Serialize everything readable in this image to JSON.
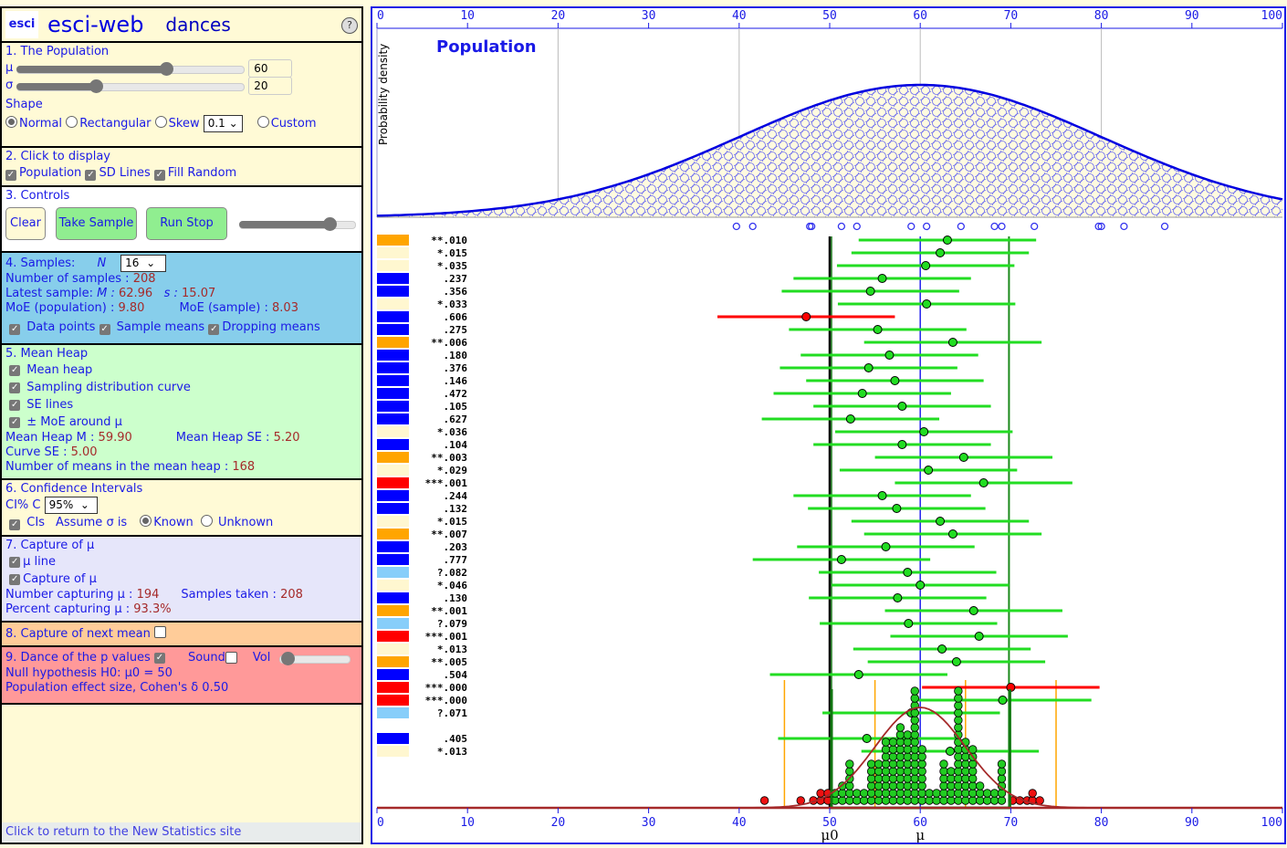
{
  "app": {
    "name": "esci-web",
    "module": "dances",
    "logo": "esci",
    "help_icon": "?"
  },
  "population": {
    "heading": "1. The Population",
    "mu_label": "μ",
    "mu_value": "60",
    "mu_fraction": 0.6,
    "sigma_label": "σ",
    "sigma_value": "20",
    "sigma_fraction": 0.35,
    "shape_label": "Shape",
    "shapes": [
      {
        "label": "Normal",
        "selected": true
      },
      {
        "label": "Rectangular",
        "selected": false
      },
      {
        "label": "Skew",
        "selected": false
      },
      {
        "label": "Custom",
        "selected": false
      }
    ],
    "skew_value": "0.1"
  },
  "display": {
    "heading": "2. Click to display",
    "options": [
      {
        "label": "Population",
        "checked": true
      },
      {
        "label": "SD Lines",
        "checked": true
      },
      {
        "label": "Fill Random",
        "checked": true
      }
    ]
  },
  "controls": {
    "heading": "3. Controls",
    "clear": "Clear",
    "take_sample": "Take Sample",
    "run_stop": "Run Stop",
    "speed_fraction": 0.78
  },
  "samples": {
    "heading": "4. Samples:",
    "n_label": "N",
    "n_value": "16",
    "num_samples_label": "Number of samples :",
    "num_samples": "208",
    "latest_label": "Latest sample:",
    "m_label": "M :",
    "m_value": "62.96",
    "s_label": "s :",
    "s_value": "15.07",
    "moe_pop_label": "MoE (population) :",
    "moe_pop": "9.80",
    "moe_sample_label": "MoE (sample) :",
    "moe_sample": "8.03",
    "options": [
      {
        "label": "Data points",
        "checked": true
      },
      {
        "label": "Sample means",
        "checked": true
      },
      {
        "label": "Dropping means",
        "checked": true
      }
    ]
  },
  "mean_heap": {
    "heading": "5. Mean Heap",
    "options": [
      {
        "label": "Mean heap",
        "checked": true
      },
      {
        "label": "Sampling distribution curve",
        "checked": true
      },
      {
        "label": "SE lines",
        "checked": true
      },
      {
        "label": "± MoE around μ",
        "checked": true
      }
    ],
    "m_label": "Mean Heap M :",
    "m_value": "59.90",
    "se_label": "Mean Heap SE :",
    "se_value": "5.20",
    "curve_se_label": "Curve SE :",
    "curve_se": "5.00",
    "count_label": "Number of means in the mean heap :",
    "count": "168"
  },
  "ci": {
    "heading": "6. Confidence Intervals",
    "ci_label": "CI% C",
    "ci_value": "95%",
    "cis_label": "CIs",
    "cis_checked": true,
    "assume_label": "Assume σ is",
    "known": "Known",
    "unknown": "Unknown",
    "known_selected": true
  },
  "capture": {
    "heading": "7. Capture of μ",
    "options": [
      {
        "label": "μ line",
        "checked": true
      },
      {
        "label": "Capture of μ",
        "checked": true
      }
    ],
    "num_label": "Number capturing μ :",
    "num": "194",
    "taken_label": "Samples taken :",
    "taken": "208",
    "pct_label": "Percent capturing μ :",
    "pct": "93.3%"
  },
  "next_mean": {
    "heading": "8. Capture of next mean",
    "checked": false
  },
  "pvalues": {
    "heading": "9. Dance of the p values",
    "checked": true,
    "sound_label": "Sound",
    "sound_checked": false,
    "vol_label": "Vol",
    "vol_fraction": 0.1,
    "h0_label": "Null hypothesis H0: μ0 = 50",
    "effect_label": "Population effect size, Cohen's δ 0.50"
  },
  "footer_link": "Click to return to the New Statistics site",
  "colors": {
    "sig3": "#ff0000",
    "sig2": "#ffa500",
    "sig1": "#fff7d0",
    "marginal": "#87cefa",
    "ns": "#0000ff",
    "ci_capture": "#22dd22",
    "ci_miss": "#ff0000"
  },
  "chart_data": {
    "type": "scatter",
    "title": "Population",
    "ylabel": "Probability density",
    "xlim": [
      0,
      100
    ],
    "x_ticks": [
      0,
      10,
      20,
      30,
      40,
      50,
      60,
      70,
      80,
      90,
      100
    ],
    "mu": 60,
    "sigma": 20,
    "mu0": 50,
    "moe": 9.8,
    "se": 5.0,
    "mu_label": "μ",
    "mu0_label": "μ0",
    "latest_sample_points": [
      39.7,
      41.5,
      47.8,
      48.0,
      51.3,
      53.0,
      59.0,
      60.7,
      64.5,
      68.2,
      69.0,
      72.6,
      79.7,
      80.0,
      82.5,
      87.0
    ],
    "intervals": [
      {
        "p": "**.010",
        "cat": "sig2",
        "mean": 63.0
      },
      {
        "p": "*.015",
        "cat": "sig1",
        "mean": 62.2
      },
      {
        "p": "*.035",
        "cat": "sig1",
        "mean": 60.6
      },
      {
        "p": ".237",
        "cat": "ns",
        "mean": 55.8
      },
      {
        "p": ".356",
        "cat": "ns",
        "mean": 54.5
      },
      {
        "p": "*.033",
        "cat": "sig1",
        "mean": 60.7
      },
      {
        "p": ".606",
        "cat": "ns",
        "mean": 47.4,
        "miss": true
      },
      {
        "p": ".275",
        "cat": "ns",
        "mean": 55.3
      },
      {
        "p": "**.006",
        "cat": "sig2",
        "mean": 63.6
      },
      {
        "p": ".180",
        "cat": "ns",
        "mean": 56.6
      },
      {
        "p": ".376",
        "cat": "ns",
        "mean": 54.3
      },
      {
        "p": ".146",
        "cat": "ns",
        "mean": 57.2
      },
      {
        "p": ".472",
        "cat": "ns",
        "mean": 53.6
      },
      {
        "p": ".105",
        "cat": "ns",
        "mean": 58.0
      },
      {
        "p": ".627",
        "cat": "ns",
        "mean": 52.3
      },
      {
        "p": "*.036",
        "cat": "sig1",
        "mean": 60.4
      },
      {
        "p": ".104",
        "cat": "ns",
        "mean": 58.0
      },
      {
        "p": "**.003",
        "cat": "sig2",
        "mean": 64.8
      },
      {
        "p": "*.029",
        "cat": "sig1",
        "mean": 60.9
      },
      {
        "p": "***.001",
        "cat": "sig3",
        "mean": 67.0
      },
      {
        "p": ".244",
        "cat": "ns",
        "mean": 55.8
      },
      {
        "p": ".132",
        "cat": "ns",
        "mean": 57.4
      },
      {
        "p": "*.015",
        "cat": "sig1",
        "mean": 62.2
      },
      {
        "p": "**.007",
        "cat": "sig2",
        "mean": 63.6
      },
      {
        "p": ".203",
        "cat": "ns",
        "mean": 56.2
      },
      {
        "p": ".777",
        "cat": "ns",
        "mean": 51.3
      },
      {
        "p": "?.082",
        "cat": "marginal",
        "mean": 58.6
      },
      {
        "p": "*.046",
        "cat": "sig1",
        "mean": 60.0
      },
      {
        "p": ".130",
        "cat": "ns",
        "mean": 57.5
      },
      {
        "p": "**.001",
        "cat": "sig2",
        "mean": 65.9
      },
      {
        "p": "?.079",
        "cat": "marginal",
        "mean": 58.7
      },
      {
        "p": "***.001",
        "cat": "sig3",
        "mean": 66.5
      },
      {
        "p": "*.013",
        "cat": "sig1",
        "mean": 62.4
      },
      {
        "p": "**.005",
        "cat": "sig2",
        "mean": 64.0
      },
      {
        "p": ".504",
        "cat": "ns",
        "mean": 53.2
      },
      {
        "p": "***.000",
        "cat": "sig3",
        "mean": 70.0,
        "miss": true
      },
      {
        "p": "***.000",
        "cat": "sig3",
        "mean": 69.1
      },
      {
        "p": "?.071",
        "cat": "marginal",
        "mean": 59.0
      },
      {
        "p": "",
        "cat": "",
        "mean": null
      },
      {
        "p": ".405",
        "cat": "ns",
        "mean": 54.1
      },
      {
        "p": "*.013",
        "cat": "sig1",
        "mean": 63.3
      }
    ],
    "heap_bins": [
      {
        "x": 42.8,
        "n": 1,
        "miss": true
      },
      {
        "x": 46.8,
        "n": 1,
        "miss": true
      },
      {
        "x": 48.2,
        "n": 1,
        "miss": true
      },
      {
        "x": 49.0,
        "n": 2,
        "miss": true
      },
      {
        "x": 49.8,
        "n": 2,
        "miss": true
      },
      {
        "x": 50.6,
        "n": 2
      },
      {
        "x": 51.4,
        "n": 3
      },
      {
        "x": 52.2,
        "n": 6
      },
      {
        "x": 53.0,
        "n": 2
      },
      {
        "x": 53.8,
        "n": 2
      },
      {
        "x": 54.6,
        "n": 6
      },
      {
        "x": 55.4,
        "n": 6
      },
      {
        "x": 56.2,
        "n": 9
      },
      {
        "x": 57.0,
        "n": 9
      },
      {
        "x": 57.8,
        "n": 11
      },
      {
        "x": 58.6,
        "n": 10
      },
      {
        "x": 59.4,
        "n": 16
      },
      {
        "x": 60.2,
        "n": 8
      },
      {
        "x": 61.0,
        "n": 2
      },
      {
        "x": 61.8,
        "n": 2
      },
      {
        "x": 62.6,
        "n": 6
      },
      {
        "x": 63.4,
        "n": 5
      },
      {
        "x": 64.2,
        "n": 16
      },
      {
        "x": 65.0,
        "n": 9
      },
      {
        "x": 65.8,
        "n": 8
      },
      {
        "x": 66.6,
        "n": 3
      },
      {
        "x": 67.4,
        "n": 2
      },
      {
        "x": 68.2,
        "n": 2
      },
      {
        "x": 69.0,
        "n": 6
      },
      {
        "x": 70.2,
        "n": 1,
        "miss": true
      },
      {
        "x": 71.0,
        "n": 1,
        "miss": true
      },
      {
        "x": 71.8,
        "n": 1,
        "miss": true
      },
      {
        "x": 72.4,
        "n": 2,
        "miss": true
      },
      {
        "x": 73.2,
        "n": 1,
        "miss": true
      }
    ]
  }
}
